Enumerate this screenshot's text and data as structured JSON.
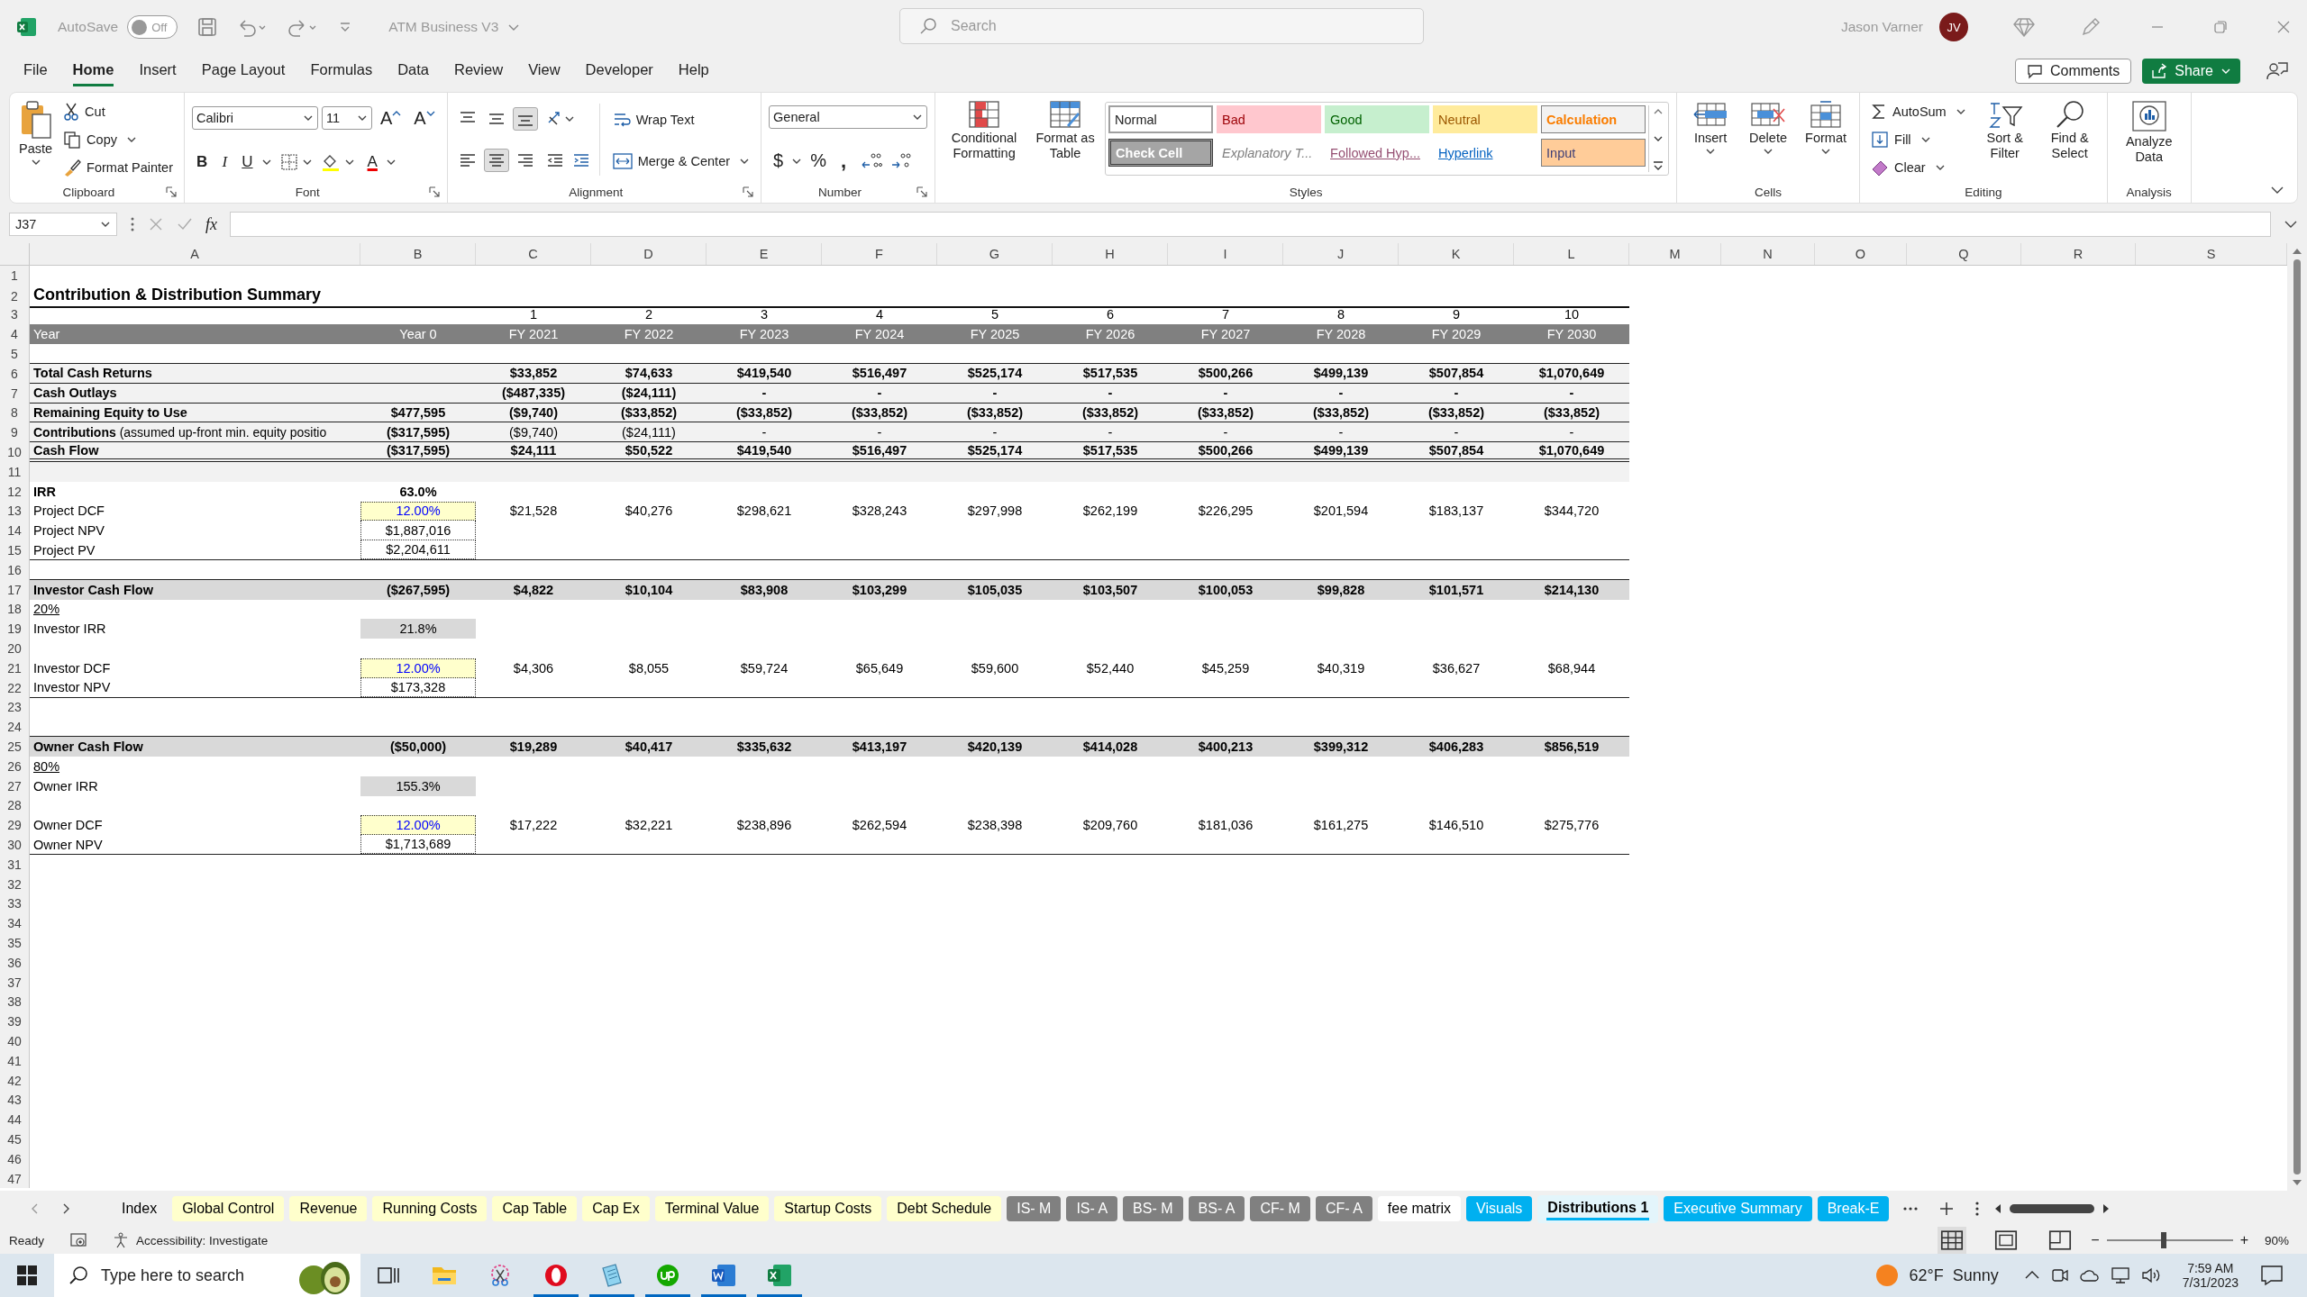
{
  "title_bar": {
    "autosave": {
      "label": "AutoSave",
      "state": "Off",
      "on": false
    },
    "file_name": "ATM Business V3",
    "search": {
      "placeholder": "Search"
    },
    "user": {
      "name": "Jason Varner",
      "initials": "JV"
    }
  },
  "menu": {
    "tabs": [
      {
        "label": "File",
        "selected": false
      },
      {
        "label": "Home",
        "selected": true
      },
      {
        "label": "Insert",
        "selected": false
      },
      {
        "label": "Page Layout",
        "selected": false
      },
      {
        "label": "Formulas",
        "selected": false
      },
      {
        "label": "Data",
        "selected": false
      },
      {
        "label": "Review",
        "selected": false
      },
      {
        "label": "View",
        "selected": false
      },
      {
        "label": "Developer",
        "selected": false
      },
      {
        "label": "Help",
        "selected": false
      }
    ],
    "comments": "Comments",
    "share": "Share"
  },
  "ribbon": {
    "clipboard": {
      "label": "Clipboard",
      "paste": "Paste",
      "cut": "Cut",
      "copy": "Copy",
      "format_painter": "Format Painter"
    },
    "font": {
      "label": "Font",
      "name": "Calibri",
      "size": "11",
      "grow": "A",
      "shrink": "A",
      "bold": "B",
      "italic": "I",
      "underline": "U",
      "font_color": "A"
    },
    "alignment": {
      "label": "Alignment",
      "wrap_text": "Wrap Text",
      "merge": "Merge & Center",
      "vertical": [
        {
          "selected": false
        },
        {
          "selected": false
        },
        {
          "selected": true
        }
      ],
      "horizontal": [
        {
          "selected": false
        },
        {
          "selected": true
        },
        {
          "selected": false
        }
      ]
    },
    "number": {
      "label": "Number",
      "format": "General",
      "currency": "$",
      "percent": "%",
      "comma": ","
    },
    "styles": {
      "label": "Styles",
      "conditional": "Conditional Formatting",
      "format_table": "Format as Table",
      "gallery": [
        {
          "label": "Normal",
          "kind": "normal"
        },
        {
          "label": "Bad",
          "kind": "bad"
        },
        {
          "label": "Good",
          "kind": "good"
        },
        {
          "label": "Neutral",
          "kind": "neutral"
        },
        {
          "label": "Calculation",
          "kind": "calculation"
        },
        {
          "label": "Check Cell",
          "kind": "check"
        },
        {
          "label": "Explanatory T...",
          "kind": "explanatory"
        },
        {
          "label": "Followed Hyp...",
          "kind": "followed"
        },
        {
          "label": "Hyperlink",
          "kind": "hyperlink"
        },
        {
          "label": "Input",
          "kind": "input"
        }
      ]
    },
    "cells": {
      "label": "Cells",
      "buttons": [
        {
          "label": "Insert",
          "kind": "insert"
        },
        {
          "label": "Delete",
          "kind": "delete"
        },
        {
          "label": "Format",
          "kind": "format"
        }
      ]
    },
    "editing": {
      "label": "Editing",
      "autosum": "AutoSum",
      "fill": "Fill",
      "clear": "Clear",
      "sort": "Sort & Filter",
      "find": "Find & Select"
    },
    "analysis": {
      "label": "Analysis",
      "analyze": "Analyze Data"
    }
  },
  "formula_bar": {
    "name_box": "J37",
    "fx": "fx"
  },
  "sheet": {
    "columns": [
      "A",
      "B",
      "C",
      "D",
      "E",
      "F",
      "G",
      "H",
      "I",
      "J",
      "K",
      "L",
      "M",
      "N",
      "O",
      "Q",
      "R",
      "S"
    ],
    "rows": [
      {
        "num": "1",
        "kind": "blank"
      },
      {
        "num": "2",
        "kind": "title",
        "thick_rule": true,
        "cells": [
          "Contribution & Distribution Summary"
        ]
      },
      {
        "num": "3",
        "kind": "index",
        "cells": [
          null,
          null,
          "1",
          "2",
          "3",
          "4",
          "5",
          "6",
          "7",
          "8",
          "9",
          "10"
        ]
      },
      {
        "num": "4",
        "kind": "header",
        "cells": [
          "Year",
          "Year 0",
          "FY 2021",
          "FY 2022",
          "FY 2023",
          "FY 2024",
          "FY 2025",
          "FY 2026",
          "FY 2027",
          "FY 2028",
          "FY 2029",
          "FY 2030"
        ]
      },
      {
        "num": "5",
        "kind": "blank",
        "rule": true
      },
      {
        "num": "6",
        "kind": "total",
        "rule": true,
        "cells": [
          "Total Cash Returns",
          null,
          "$33,852",
          "$74,633",
          "$419,540",
          "$516,497",
          "$525,174",
          "$517,535",
          "$500,266",
          "$499,139",
          "$507,854",
          "$1,070,649"
        ]
      },
      {
        "num": "7",
        "kind": "total",
        "rule": true,
        "cells": [
          "Cash Outlays",
          null,
          "($487,335)",
          "($24,111)",
          "-",
          "-",
          "-",
          "-",
          "-",
          "-",
          "-",
          "-"
        ]
      },
      {
        "num": "8",
        "kind": "total",
        "rule": true,
        "cells": [
          "Remaining Equity to Use",
          "$477,595",
          "($9,740)",
          "($33,852)",
          "($33,852)",
          "($33,852)",
          "($33,852)",
          "($33,852)",
          "($33,852)",
          "($33,852)",
          "($33,852)",
          "($33,852)"
        ]
      },
      {
        "num": "9",
        "kind": "contrib",
        "rule": true,
        "cells": [
          "**Contributions** (assumed up-front min. equity positio",
          "($317,595)",
          "($9,740)",
          "($24,111)",
          "-",
          "-",
          "-",
          "-",
          "-",
          "-",
          "-",
          "-"
        ]
      },
      {
        "num": "10",
        "kind": "total",
        "double_rule": true,
        "cells": [
          "Cash Flow",
          "($317,595)",
          "$24,111",
          "$50,522",
          "$419,540",
          "$516,497",
          "$525,174",
          "$517,535",
          "$500,266",
          "$499,139",
          "$507,854",
          "$1,070,649"
        ]
      },
      {
        "num": "11",
        "kind": "gap"
      },
      {
        "num": "12",
        "kind": "bold",
        "cells": [
          "IRR",
          "63.0%"
        ]
      },
      {
        "num": "13",
        "kind": "plain",
        "input_cell": true,
        "cells": [
          "Project DCF",
          "12.00%",
          "$21,528",
          "$40,276",
          "$298,621",
          "$328,243",
          "$297,998",
          "$262,199",
          "$226,295",
          "$201,594",
          "$183,137",
          "$344,720"
        ]
      },
      {
        "num": "14",
        "kind": "plain",
        "boxed_cell": true,
        "cells": [
          "Project NPV",
          "$1,887,016"
        ]
      },
      {
        "num": "15",
        "kind": "plain",
        "boxed_cell": true,
        "rule": true,
        "cells": [
          "Project PV",
          "$2,204,611"
        ]
      },
      {
        "num": "16",
        "kind": "blank",
        "rule": true
      },
      {
        "num": "17",
        "kind": "band",
        "cells": [
          "Investor Cash Flow",
          "($267,595)",
          "$4,822",
          "$10,104",
          "$83,908",
          "$103,299",
          "$105,035",
          "$103,507",
          "$100,053",
          "$99,828",
          "$101,571",
          "$214,130"
        ]
      },
      {
        "num": "18",
        "kind": "underline",
        "cells": [
          "20%"
        ]
      },
      {
        "num": "19",
        "kind": "plain",
        "shaded_cell": true,
        "cells": [
          "Investor IRR",
          "21.8%"
        ]
      },
      {
        "num": "20",
        "kind": "blank"
      },
      {
        "num": "21",
        "kind": "plain",
        "input_cell": true,
        "cells": [
          "Investor DCF",
          "12.00%",
          "$4,306",
          "$8,055",
          "$59,724",
          "$65,649",
          "$59,600",
          "$52,440",
          "$45,259",
          "$40,319",
          "$36,627",
          "$68,944"
        ]
      },
      {
        "num": "22",
        "kind": "plain",
        "boxed_cell": true,
        "rule": true,
        "cells": [
          "Investor NPV",
          "$173,328"
        ]
      },
      {
        "num": "23",
        "kind": "blank"
      },
      {
        "num": "24",
        "kind": "blank",
        "rule": true
      },
      {
        "num": "25",
        "kind": "band",
        "cells": [
          "Owner Cash Flow",
          "($50,000)",
          "$19,289",
          "$40,417",
          "$335,632",
          "$413,197",
          "$420,139",
          "$414,028",
          "$400,213",
          "$399,312",
          "$406,283",
          "$856,519"
        ]
      },
      {
        "num": "26",
        "kind": "underline",
        "cells": [
          "80%"
        ]
      },
      {
        "num": "27",
        "kind": "plain",
        "shaded_cell": true,
        "cells": [
          "Owner IRR",
          "155.3%"
        ]
      },
      {
        "num": "28",
        "kind": "blank"
      },
      {
        "num": "29",
        "kind": "plain",
        "input_cell": true,
        "cells": [
          "Owner DCF",
          "12.00%",
          "$17,222",
          "$32,221",
          "$238,896",
          "$262,594",
          "$238,398",
          "$209,760",
          "$181,036",
          "$161,275",
          "$146,510",
          "$275,776"
        ]
      },
      {
        "num": "30",
        "kind": "plain",
        "boxed_cell": true,
        "rule": true,
        "cells": [
          "Owner NPV",
          "$1,713,689"
        ]
      },
      {
        "num": "31",
        "kind": "blank"
      },
      {
        "num": "32",
        "kind": "blank"
      },
      {
        "num": "33",
        "kind": "blank"
      },
      {
        "num": "34",
        "kind": "blank"
      },
      {
        "num": "35",
        "kind": "blank"
      },
      {
        "num": "36",
        "kind": "blank"
      },
      {
        "num": "37",
        "kind": "blank"
      },
      {
        "num": "38",
        "kind": "blank"
      },
      {
        "num": "39",
        "kind": "blank"
      },
      {
        "num": "40",
        "kind": "blank"
      },
      {
        "num": "41",
        "kind": "blank"
      },
      {
        "num": "42",
        "kind": "blank"
      },
      {
        "num": "43",
        "kind": "blank"
      },
      {
        "num": "44",
        "kind": "blank"
      },
      {
        "num": "45",
        "kind": "blank"
      },
      {
        "num": "46",
        "kind": "blank"
      },
      {
        "num": "47",
        "kind": "blank"
      }
    ]
  },
  "sheet_tabs": [
    {
      "label": "Index",
      "selected": false
    },
    {
      "label": "Global Control",
      "color": "#ffffcc",
      "selected": false
    },
    {
      "label": "Revenue",
      "color": "#ffffcc",
      "selected": false
    },
    {
      "label": "Running Costs",
      "color": "#ffffcc",
      "selected": false
    },
    {
      "label": "Cap Table",
      "color": "#ffffcc",
      "selected": false
    },
    {
      "label": "Cap Ex",
      "color": "#ffffcc",
      "selected": false
    },
    {
      "label": "Terminal Value",
      "color": "#ffffcc",
      "selected": false
    },
    {
      "label": "Startup Costs",
      "color": "#ffffcc",
      "selected": false
    },
    {
      "label": "Debt Schedule",
      "color": "#ffffcc",
      "selected": false
    },
    {
      "label": "IS- M",
      "color": "#808080",
      "selected": false
    },
    {
      "label": "IS- A",
      "color": "#808080",
      "selected": false
    },
    {
      "label": "BS- M",
      "color": "#808080",
      "selected": false
    },
    {
      "label": "BS- A",
      "color": "#808080",
      "selected": false
    },
    {
      "label": "CF- M",
      "color": "#808080",
      "selected": false
    },
    {
      "label": "CF- A",
      "color": "#808080",
      "selected": false
    },
    {
      "label": "fee matrix",
      "color": "#ffffff",
      "selected": false
    },
    {
      "label": "Visuals",
      "color": "#00b0f0",
      "selected": false
    },
    {
      "label": "Distributions 1",
      "color": "#00b0f0",
      "selected": true
    },
    {
      "label": "Executive Summary",
      "color": "#00b0f0",
      "selected": false
    },
    {
      "label": "Break-E",
      "color": "#00b0f0",
      "selected": false
    }
  ],
  "status_bar": {
    "ready": "Ready",
    "accessibility": "Accessibility: Investigate",
    "zoom": {
      "out": "−",
      "in": "+",
      "level": 0.45,
      "reading": "90%"
    }
  },
  "taskbar": {
    "search": {
      "placeholder": "Type here to search"
    },
    "apps": [
      {
        "kind": "task-view",
        "running": false
      },
      {
        "kind": "folder",
        "running": false
      },
      {
        "kind": "snip",
        "running": false
      },
      {
        "kind": "opera",
        "running": true
      },
      {
        "kind": "notepad",
        "running": true
      },
      {
        "kind": "upwork",
        "running": true
      },
      {
        "kind": "word",
        "running": true
      },
      {
        "kind": "excel",
        "running": true
      }
    ],
    "weather": {
      "temp": "62°F",
      "sky": "Sunny"
    },
    "time": "7:59 AM",
    "date": "7/31/2023"
  }
}
